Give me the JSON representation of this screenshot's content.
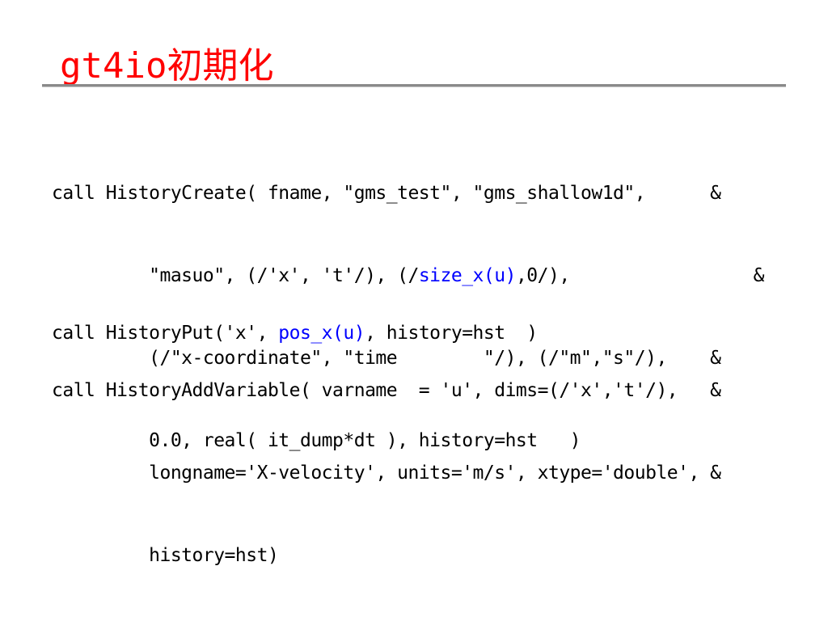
{
  "slide": {
    "title": "gt4io初期化",
    "colors": {
      "title": "#ff0000",
      "highlight": "#0000ff",
      "text": "#000000",
      "rule": "#8a8a8a"
    }
  },
  "code": {
    "block1": {
      "line1": "call HistoryCreate( fname, \"gms_test\", \"gms_shallow1d\",      &",
      "line2_pre": "         \"masuo\", (/'x', 't'/), (/",
      "line2_hl": "size_x(u)",
      "line2_post": ",0/),                 &",
      "line3": "         (/\"x-coordinate\", \"time        \"/), (/\"m\",\"s\"/),    &",
      "line4": "         0.0, real( it_dump*dt ), history=hst   )"
    },
    "block2": {
      "line1_pre": "call HistoryPut('x', ",
      "line1_hl": "pos_x(u)",
      "line1_post": ", history=hst  )"
    },
    "block3": {
      "line1": "call HistoryAddVariable( varname  = 'u', dims=(/'x','t'/),   &",
      "line2": "         longname='X-velocity', units='m/s', xtype='double', &",
      "line3": "         history=hst)"
    }
  }
}
